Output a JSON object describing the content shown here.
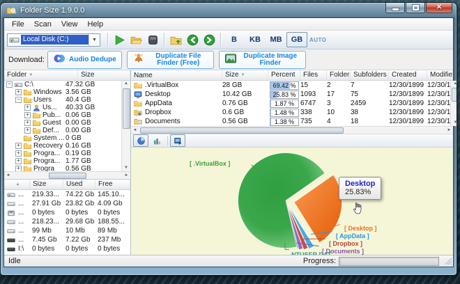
{
  "window": {
    "title": "Folder Size 1.9.0.0"
  },
  "menu": {
    "items": [
      "File",
      "Scan",
      "View",
      "Help"
    ]
  },
  "toolbar": {
    "drive_selector": "Local Disk (C:)",
    "units": [
      "B",
      "KB",
      "MB",
      "GB"
    ],
    "active_unit": "GB",
    "auto_label": "AUTO"
  },
  "download_bar": {
    "label": "Download:",
    "buttons": [
      {
        "label": "Audio Dedupe",
        "icon": "audio-dedupe"
      },
      {
        "label": "Duplicate File Finder (Free)",
        "icon": "duplicate-file-finder"
      },
      {
        "label": "Duplicate Image Finder",
        "icon": "duplicate-image-finder"
      }
    ]
  },
  "folder_tree": {
    "columns": {
      "folder": "Folder",
      "size": "Size"
    },
    "items": [
      {
        "label": "C:\\",
        "size": "47.32 GB",
        "level": 0,
        "expander": "-",
        "icon": "drive-windows"
      },
      {
        "label": "Windows",
        "size": "3.56 GB",
        "level": 1,
        "expander": "+",
        "icon": "folder"
      },
      {
        "label": "Users",
        "size": "40.4 GB",
        "level": 1,
        "expander": "-",
        "icon": "folder"
      },
      {
        "label": "Us...",
        "size": "40.33 GB",
        "level": 2,
        "expander": "+",
        "icon": "user-folder"
      },
      {
        "label": "Pub...",
        "size": "0.06 GB",
        "level": 2,
        "expander": "+",
        "icon": "folder"
      },
      {
        "label": "Guest",
        "size": "0.00 GB",
        "level": 2,
        "expander": "+",
        "icon": "folder"
      },
      {
        "label": "Def...",
        "size": "0.00 GB",
        "level": 2,
        "expander": "+",
        "icon": "folder"
      },
      {
        "label": "System ...",
        "size": "0 GB",
        "level": 1,
        "expander": "",
        "icon": "folder"
      },
      {
        "label": "Recovery",
        "size": "0.16 GB",
        "level": 1,
        "expander": "+",
        "icon": "folder"
      },
      {
        "label": "Progra...",
        "size": "0.19 GB",
        "level": 1,
        "expander": "+",
        "icon": "folder"
      },
      {
        "label": "Progra...",
        "size": "1.77 GB",
        "level": 1,
        "expander": "+",
        "icon": "folder"
      },
      {
        "label": "Progra",
        "size": "0.56 GB",
        "level": 1,
        "expander": "+",
        "icon": "folder"
      }
    ]
  },
  "drives_table": {
    "columns": [
      "",
      "Size",
      "Used",
      "Free"
    ],
    "rows": [
      {
        "icon": "drive-windows",
        "label": "...",
        "size": "219.33...",
        "used": "74.22 Gb",
        "free": "145.10..."
      },
      {
        "icon": "drive",
        "label": "...",
        "size": "27.91 Gb",
        "used": "23.82 Gb",
        "free": "4.09 Gb"
      },
      {
        "icon": "floppy",
        "label": "...",
        "size": "0 bytes",
        "used": "0 bytes",
        "free": "0 bytes"
      },
      {
        "icon": "drive",
        "label": "...",
        "size": "218.23...",
        "used": "29.68 Gb",
        "free": "188.55..."
      },
      {
        "icon": "drive",
        "label": "...",
        "size": "99 Mb",
        "used": "10 Mb",
        "free": "89 Mb"
      },
      {
        "icon": "drive-black",
        "label": "...",
        "size": "7.45 Gb",
        "used": "7.22 Gb",
        "free": "237 Mb"
      },
      {
        "icon": "drive-black",
        "label": "I:\\",
        "size": "0 bytes",
        "used": "0 bytes",
        "free": "0 bytes"
      }
    ]
  },
  "main_table": {
    "columns": [
      "Name",
      "Size",
      "Percent",
      "Files",
      "Folders",
      "Subfolders",
      "Created",
      "Modified"
    ],
    "sorted_column": "Size",
    "rows": [
      {
        "icon": "folder",
        "name": ".VirtualBox",
        "size": "28 GB",
        "percent": "69.42 %",
        "percent_value": 69.42,
        "files": "15",
        "folders": "2",
        "subfolders": "7",
        "created": "12/30/1899",
        "modified": "12/30/1"
      },
      {
        "icon": "desktop",
        "name": "Desktop",
        "size": "10.42 GB",
        "percent": "25.83 %",
        "percent_value": 25.83,
        "files": "1093",
        "folders": "17",
        "subfolders": "75",
        "created": "12/30/1899",
        "modified": "12/30/1"
      },
      {
        "icon": "folder",
        "name": "AppData",
        "size": "0.76 GB",
        "percent": "1.87 %",
        "percent_value": 1.87,
        "files": "6747",
        "folders": "3",
        "subfolders": "2459",
        "created": "12/30/1899",
        "modified": "12/30/1"
      },
      {
        "icon": "dropbox",
        "name": "Dropbox",
        "size": "0.6 GB",
        "percent": "1.48 %",
        "percent_value": 1.48,
        "files": "338",
        "folders": "10",
        "subfolders": "38",
        "created": "12/30/1899",
        "modified": "12/30/1"
      },
      {
        "icon": "documents",
        "name": "Documents",
        "size": "0.56 GB",
        "percent": "1.38 %",
        "percent_value": 1.38,
        "files": "735",
        "folders": "4",
        "subfolders": "18",
        "created": "12/30/1899",
        "modified": "12/30/1"
      }
    ]
  },
  "chart_data": {
    "type": "pie",
    "background": "#f5f6d8",
    "legend_position": "callout-labels",
    "slices": [
      {
        "label": ".VirtualBox",
        "value": 69.42,
        "color": "#3aa74b",
        "exploded": false
      },
      {
        "label": "Desktop",
        "value": 25.83,
        "color": "#ed6d12",
        "exploded": true
      },
      {
        "label": "AppData",
        "value": 1.87,
        "color": "#4aaae2",
        "exploded": true
      },
      {
        "label": "Dropbox",
        "value": 1.48,
        "color": "#bc5343",
        "exploded": true
      },
      {
        "label": "Documents",
        "value": 1.38,
        "color": "#9a68b4",
        "exploded": true
      },
      {
        "label": "NTUSER.DAT",
        "value": 0.02,
        "color": "#58b0c4",
        "exploded": true
      }
    ],
    "callouts": [
      {
        "text": "[ .VirtualBox ]",
        "color": "#3c9e3c"
      },
      {
        "text": "[ Desktop ]",
        "color": "#ee701c"
      },
      {
        "text": "[ AppData ]",
        "color": "#2a96dc"
      },
      {
        "text": "[ Dropbox ]",
        "color": "#b04636"
      },
      {
        "text": "[ Documents ]",
        "color": "#8a50a8"
      },
      {
        "text": "NTUSER.DAT",
        "color": "#2f9488"
      }
    ],
    "tooltip": {
      "title": "Desktop",
      "value": "25.83%"
    }
  },
  "status_bar": {
    "left": "Idle",
    "progress_label": "Progress:"
  }
}
